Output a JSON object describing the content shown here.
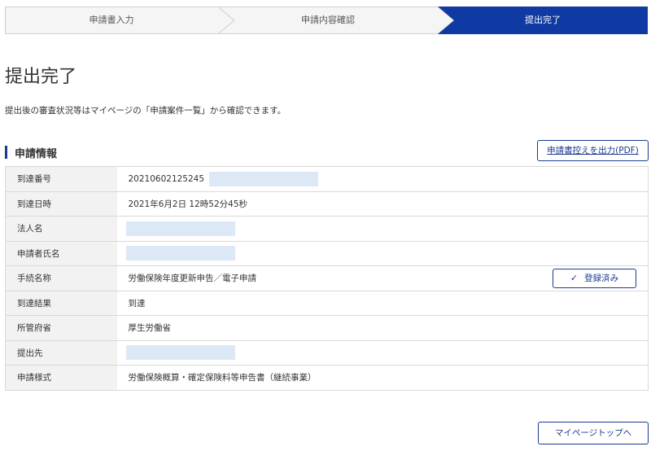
{
  "stepper": {
    "steps": [
      {
        "label": "申請書入力",
        "state": "done"
      },
      {
        "label": "申請内容確認",
        "state": "done"
      },
      {
        "label": "提出完了",
        "state": "current"
      }
    ],
    "active_color": "#0f3aa3"
  },
  "page_title": "提出完了",
  "description": "提出後の審査状況等はマイページの「申請案件一覧」から確認できます。",
  "section": {
    "title": "申請情報",
    "pdf_button": "申請書控えを出力(PDF)"
  },
  "table": {
    "rows": [
      {
        "label": "到達番号",
        "value": "20210602125245"
      },
      {
        "label": "到達日時",
        "value": "2021年6月2日 12時52分45秒"
      },
      {
        "label": "法人名",
        "value": ""
      },
      {
        "label": "申請者氏名",
        "value": ""
      },
      {
        "label": "手続名称",
        "value": "労働保険年度更新申告／電子申請",
        "button": "登録済み"
      },
      {
        "label": "到達結果",
        "value": "到達"
      },
      {
        "label": "所管府省",
        "value": "厚生労働省"
      },
      {
        "label": "提出先",
        "value": ""
      },
      {
        "label": "申請様式",
        "value": "労働保険概算・確定保険料等申告書（継続事業）"
      }
    ]
  },
  "mypage_button": "マイページトップへ",
  "icons": {
    "registered": "check-icon"
  }
}
